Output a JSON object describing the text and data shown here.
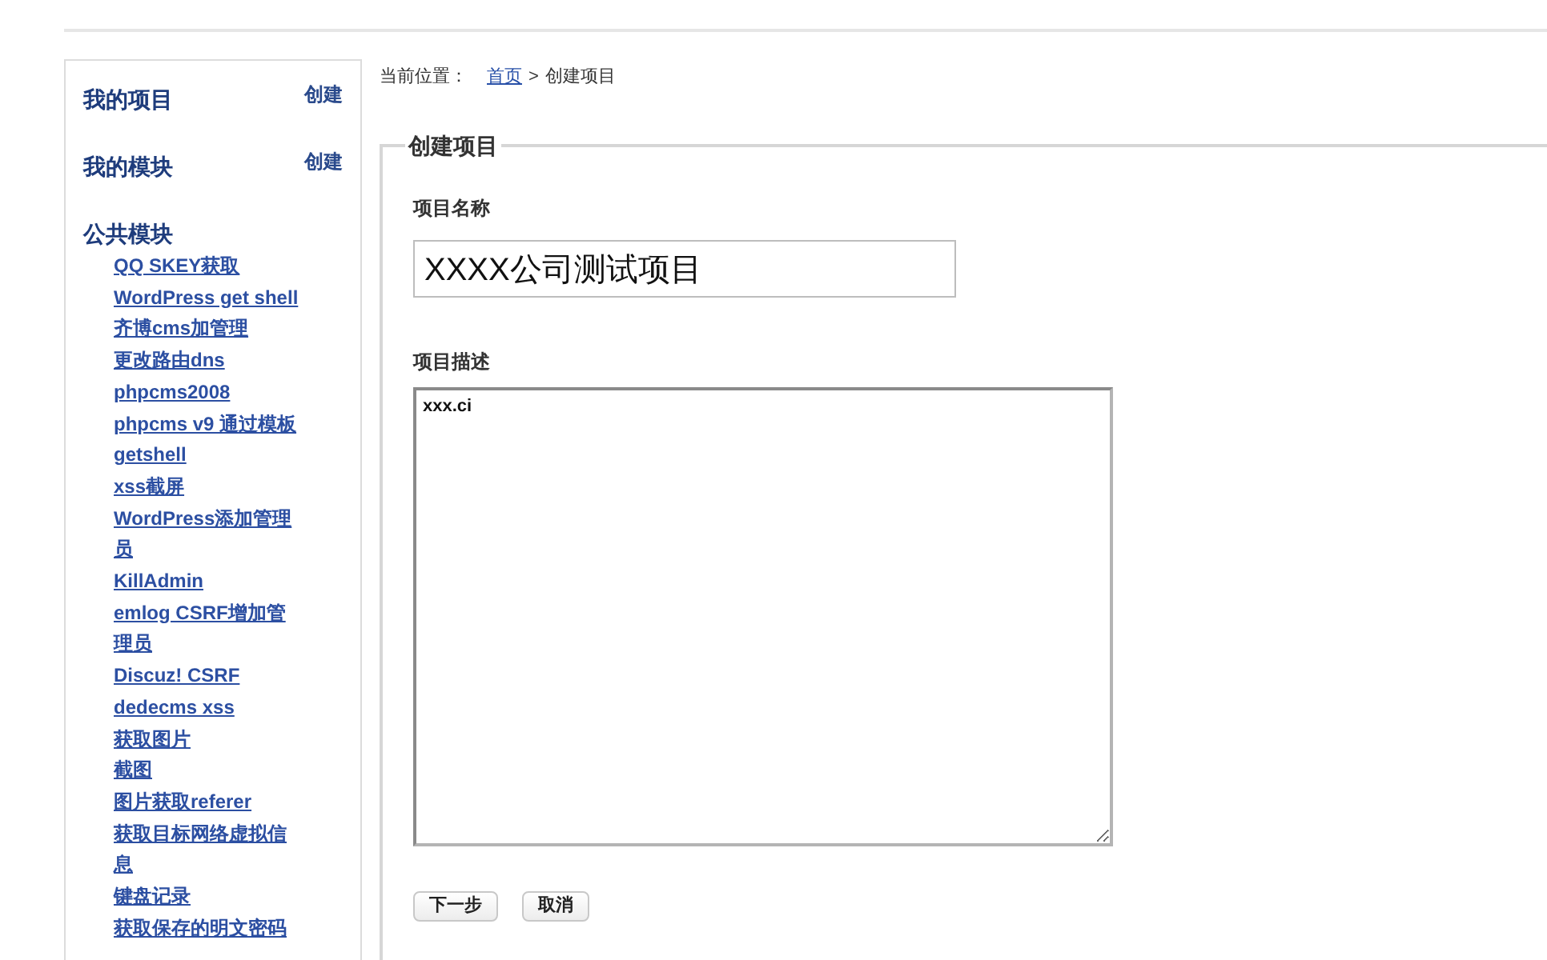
{
  "sidebar": {
    "sections": [
      {
        "title": "我的项目",
        "action": "创建"
      },
      {
        "title": "我的模块",
        "action": "创建"
      },
      {
        "title": "公共模块",
        "items": [
          "QQ SKEY获取",
          "WordPress get shell",
          "齐博cms加管理",
          "更改路由dns",
          "phpcms2008",
          "phpcms v9 通过模板",
          "getshell",
          "xss截屏",
          "WordPress添加管理员",
          "KillAdmin",
          "emlog CSRF增加管理员",
          "Discuz! CSRF",
          "dedecms xss",
          "获取图片",
          "截图",
          "图片获取referer",
          "获取目标网络虚拟信息",
          "键盘记录",
          "获取保存的明文密码"
        ]
      }
    ]
  },
  "breadcrumb": {
    "prefix": "当前位置：",
    "home": "首页",
    "separator": ">",
    "current": "创建项目"
  },
  "form": {
    "legend": "创建项目",
    "fields": [
      {
        "kind": "text",
        "label": "项目名称",
        "value": "XXXX公司测试项目"
      },
      {
        "kind": "textarea",
        "label": "项目描述",
        "value": "xxx.ci"
      }
    ],
    "buttons": [
      "下一步",
      "取消"
    ]
  }
}
